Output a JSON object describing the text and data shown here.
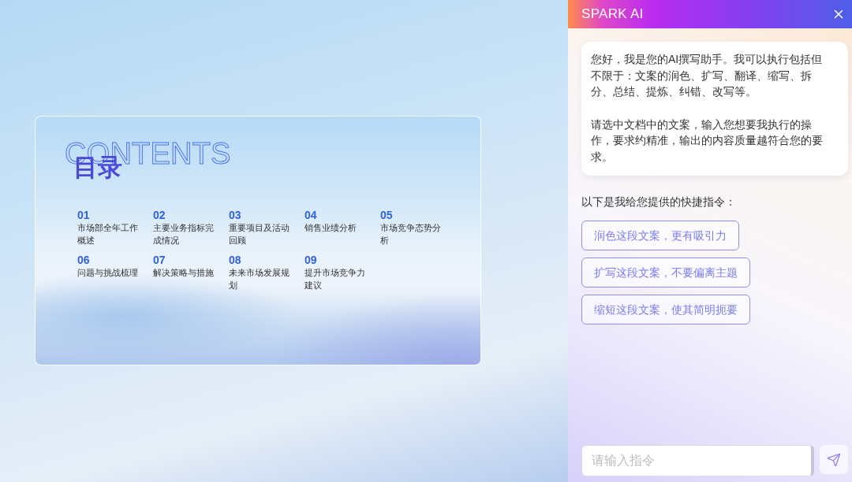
{
  "slide": {
    "title_outline": "CONTENTS",
    "title": "目录",
    "items": [
      {
        "number": "01",
        "label": "市场部全年工作概述"
      },
      {
        "number": "02",
        "label": "主要业务指标完成情况"
      },
      {
        "number": "03",
        "label": "重要项目及活动回顾"
      },
      {
        "number": "04",
        "label": "销售业绩分析"
      },
      {
        "number": "05",
        "label": "市场竞争态势分析"
      },
      {
        "number": "06",
        "label": "问题与挑战梳理"
      },
      {
        "number": "07",
        "label": "解决策略与措施"
      },
      {
        "number": "08",
        "label": "未来市场发展规划"
      },
      {
        "number": "09",
        "label": "提升市场竞争力建议"
      }
    ]
  },
  "panel": {
    "title": "SPARK AI",
    "message": [
      "您好，我是您的AI撰写助手。我可以执行包括但不限于：文案的润色、扩写、翻译、缩写、拆分、总结、提炼、纠错、改写等。",
      "请选中文档中的文案，输入您想要我执行的操作，要求约精准，输出的内容质量越符合您的要求。"
    ],
    "shortcuts_intro": "以下是我给您提供的快捷指令：",
    "shortcuts": [
      "润色这段文案，更有吸引力",
      "扩写这段文案，不要偏离主题",
      "缩短这段文案，使其简明扼要"
    ],
    "input": {
      "placeholder": "请输入指令"
    }
  }
}
